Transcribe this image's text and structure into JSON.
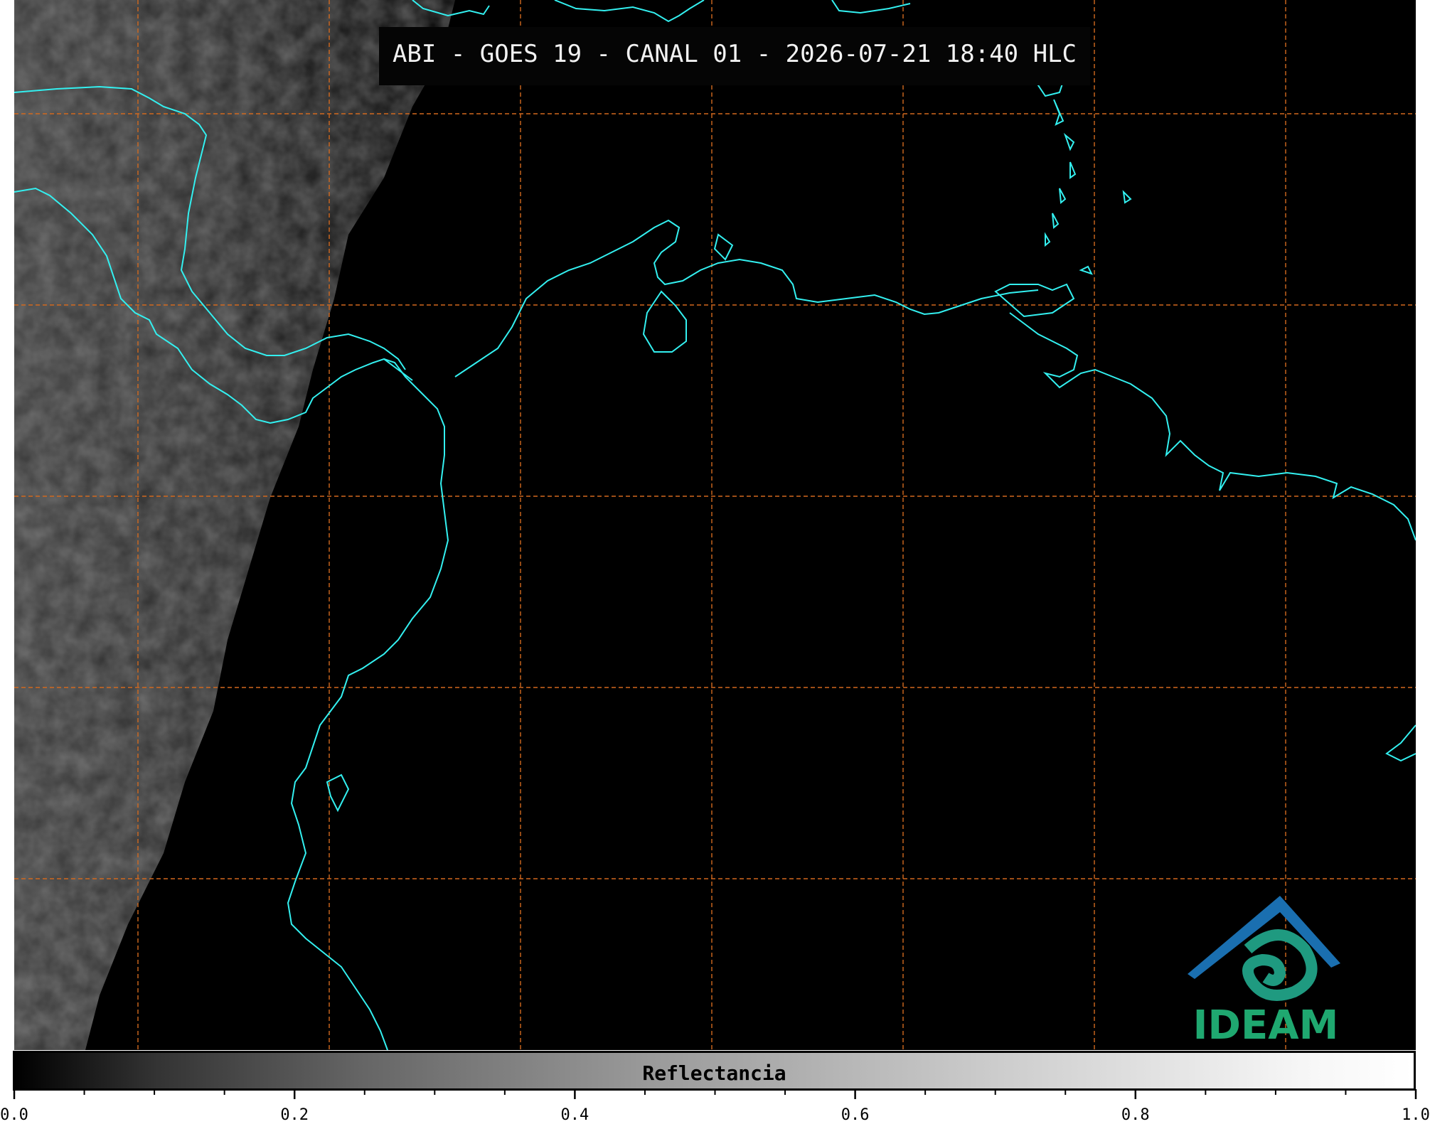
{
  "title": "ABI - GOES 19 - CANAL 01 - 2026-07-21 18:40 HLC",
  "colorbar": {
    "label": "Reflectancia",
    "range": [
      0.0,
      1.0
    ],
    "tick_labels": [
      "0.0",
      "0.2",
      "0.4",
      "0.6",
      "0.8",
      "1.0"
    ],
    "minor_ticks": [
      0.05,
      0.1,
      0.15,
      0.25,
      0.3,
      0.35,
      0.45,
      0.5,
      0.55,
      0.65,
      0.7,
      0.75,
      0.85,
      0.9,
      0.95
    ]
  },
  "logo": {
    "text": "IDEAM",
    "text_color": "#1fa870",
    "mark_colors": [
      "#1a6fb0",
      "#1fa870"
    ]
  },
  "colors": {
    "coastline": "#33f0f0",
    "grid": "#d2691e",
    "background": "#000000"
  }
}
